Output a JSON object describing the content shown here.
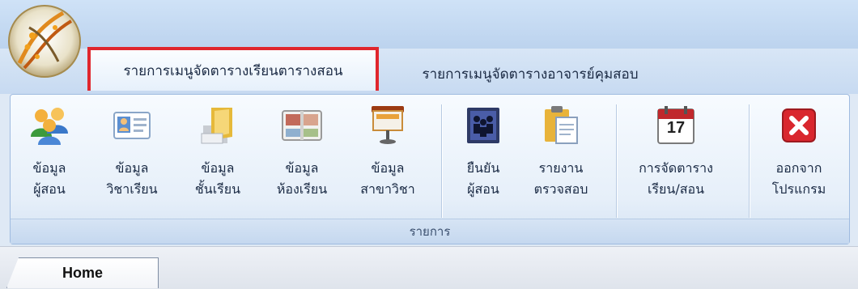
{
  "tabs": {
    "active": "รายการเมนูจัดตารางเรียนตารางสอน",
    "inactive": "รายการเมนูจัดตารางอาจารย์คุมสอบ"
  },
  "ribbon": {
    "group_label": "รายการ",
    "buttons": [
      {
        "line1": "ข้อมูล",
        "line2": "ผู้สอน",
        "icon": "users-icon"
      },
      {
        "line1": "ข้อมูล",
        "line2": "วิชาเรียน",
        "icon": "contact-card-icon"
      },
      {
        "line1": "ข้อมูล",
        "line2": "ชั้นเรียน",
        "icon": "folder-icon"
      },
      {
        "line1": "ข้อมูล",
        "line2": "ห้องเรียน",
        "icon": "photo-album-icon"
      },
      {
        "line1": "ข้อมูล",
        "line2": "สาขาวิชา",
        "icon": "presentation-board-icon"
      },
      {
        "line1": "ยืนยัน",
        "line2": "ผู้สอน",
        "icon": "group-book-icon"
      },
      {
        "line1": "รายงาน",
        "line2": "ตรวจสอบ",
        "icon": "clipboard-icon"
      },
      {
        "line1": "การจัดตาราง",
        "line2": "เรียน/สอน",
        "icon": "calendar-icon"
      },
      {
        "line1": "ออกจาก",
        "line2": "โปรแกรม",
        "icon": "exit-icon"
      }
    ],
    "calendar_day": "17"
  },
  "bottom_tab": "Home",
  "colors": {
    "highlight": "#e0262d",
    "exit": "#d9272e"
  }
}
